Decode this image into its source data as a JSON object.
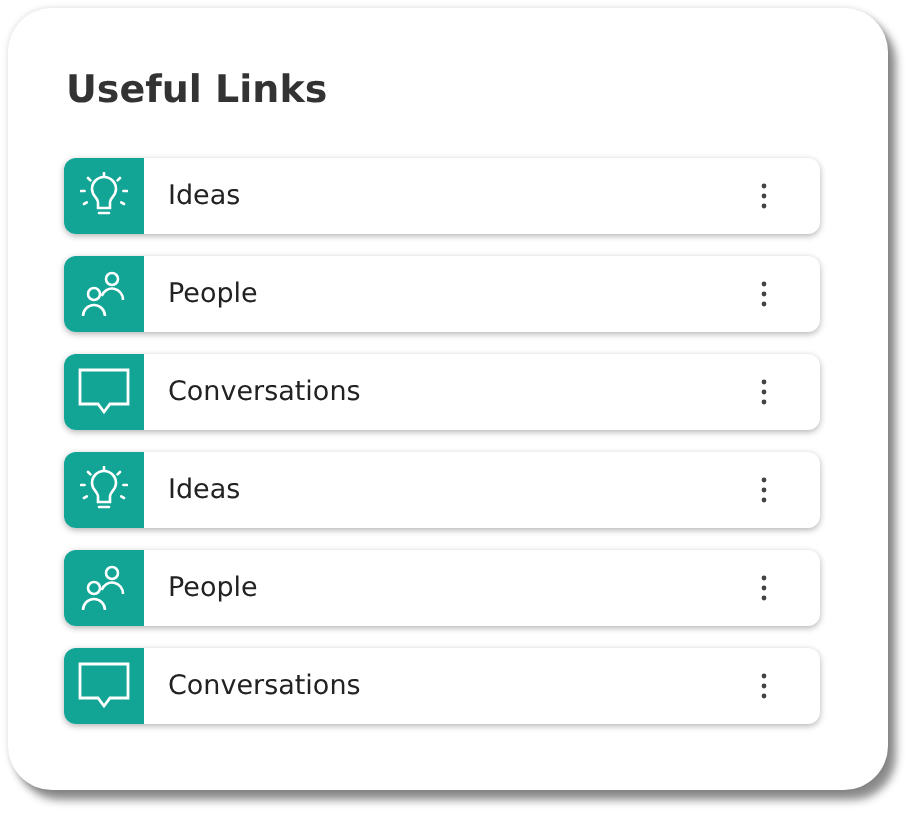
{
  "card": {
    "title": "Useful Links",
    "links": [
      {
        "kind": "idea",
        "label": "Ideas"
      },
      {
        "kind": "people",
        "label": "People"
      },
      {
        "kind": "chat",
        "label": "Conversations"
      },
      {
        "kind": "idea",
        "label": "Ideas"
      },
      {
        "kind": "people",
        "label": "People"
      },
      {
        "kind": "chat",
        "label": "Conversations"
      }
    ]
  }
}
